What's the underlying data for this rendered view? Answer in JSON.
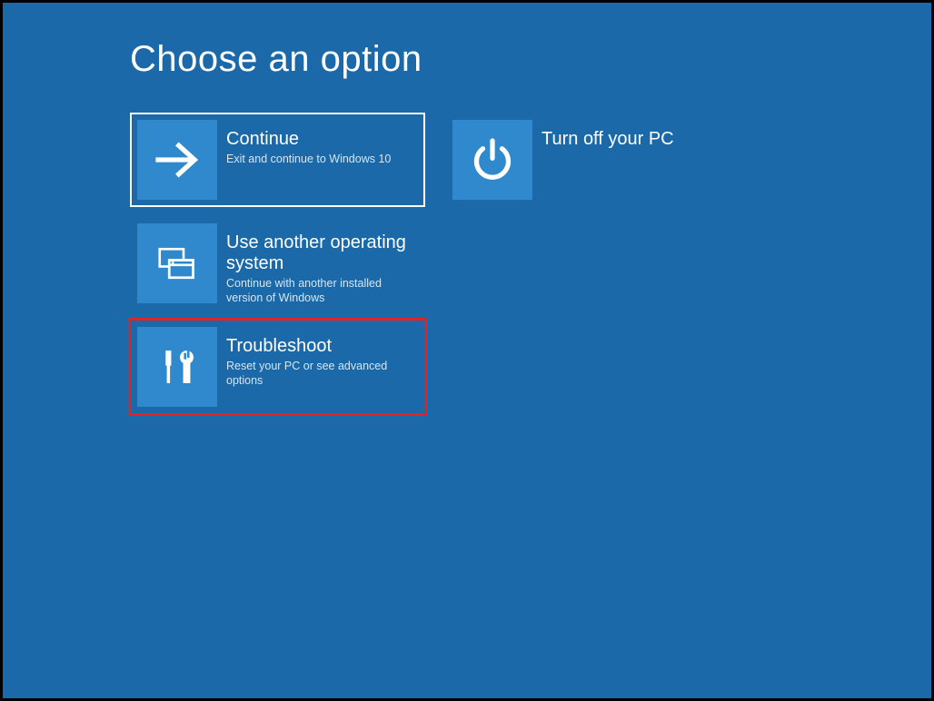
{
  "page_title": "Choose an option",
  "colors": {
    "background": "#1b69a8",
    "tile_icon_bg": "#2f89cc",
    "highlight_outline": "#e02424"
  },
  "tiles": {
    "continue": {
      "title": "Continue",
      "subtitle": "Exit and continue to Windows 10",
      "icon": "arrow-right-icon",
      "selected": true
    },
    "turn_off": {
      "title": "Turn off your PC",
      "subtitle": "",
      "icon": "power-icon"
    },
    "use_another": {
      "title": "Use another operating system",
      "subtitle": "Continue with another installed version of Windows",
      "icon": "windows-stack-icon"
    },
    "troubleshoot": {
      "title": "Troubleshoot",
      "subtitle": "Reset your PC or see advanced options",
      "icon": "tools-icon",
      "highlighted": true
    }
  }
}
